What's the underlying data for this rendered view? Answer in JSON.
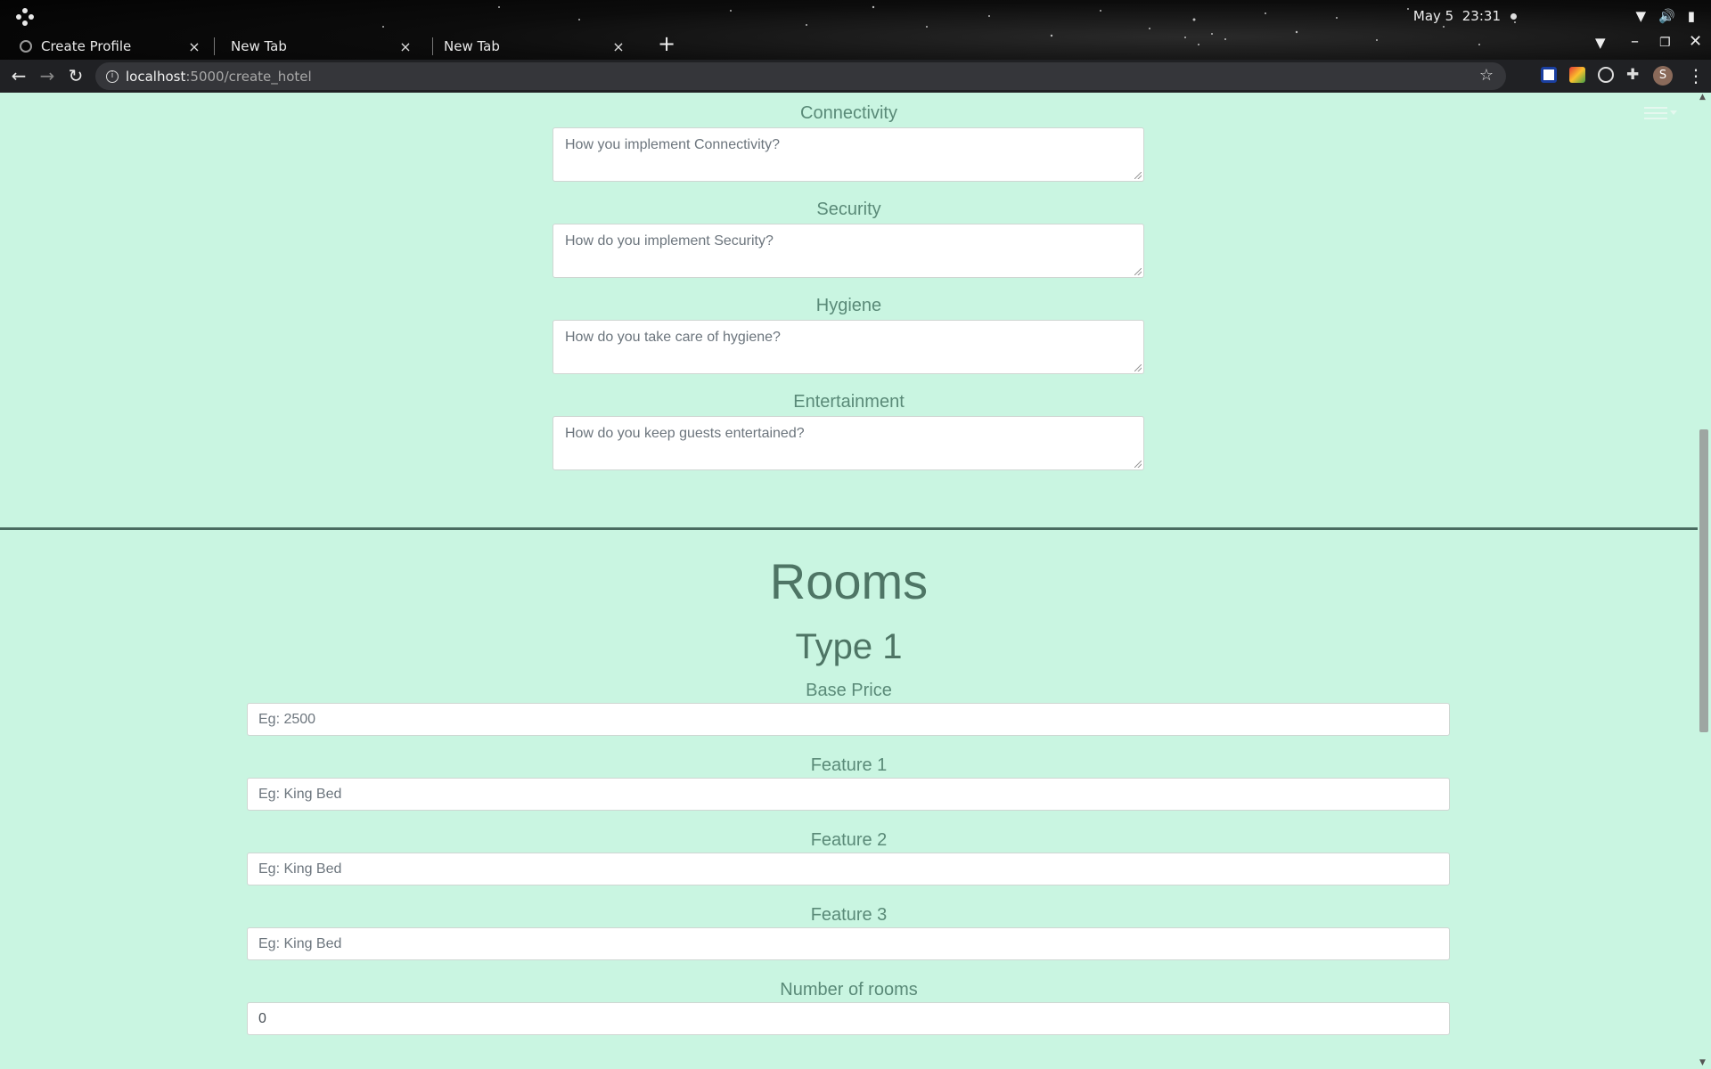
{
  "os": {
    "date": "May 5",
    "time": "23:31"
  },
  "browser": {
    "tabs": [
      {
        "title": "Create Profile",
        "close": "×"
      },
      {
        "title": "New Tab",
        "close": "×"
      },
      {
        "title": "New Tab",
        "close": "×"
      }
    ],
    "new_tab": "+",
    "url_host": "localhost",
    "url_path": ":5000/create_hotel",
    "profile_initial": "S"
  },
  "amenities": [
    {
      "label": "Connectivity",
      "placeholder": "How you implement Connectivity?"
    },
    {
      "label": "Security",
      "placeholder": "How do you implement Security?"
    },
    {
      "label": "Hygiene",
      "placeholder": "How do you take care of hygiene?"
    },
    {
      "label": "Entertainment",
      "placeholder": "How do you keep guests entertained?"
    }
  ],
  "rooms": {
    "heading": "Rooms",
    "type_heading": "Type 1",
    "fields": [
      {
        "label": "Base Price",
        "placeholder": "Eg: 2500"
      },
      {
        "label": "Feature 1",
        "placeholder": "Eg: King Bed"
      },
      {
        "label": "Feature 2",
        "placeholder": "Eg: King Bed"
      },
      {
        "label": "Feature 3",
        "placeholder": "Eg: King Bed"
      },
      {
        "label": "Number of rooms",
        "value": "0"
      }
    ]
  },
  "colors": {
    "page_bg": "#c9f5e1",
    "label_text": "#5a8a78",
    "heading_text": "#4e7565",
    "divider": "#4a6b60"
  }
}
